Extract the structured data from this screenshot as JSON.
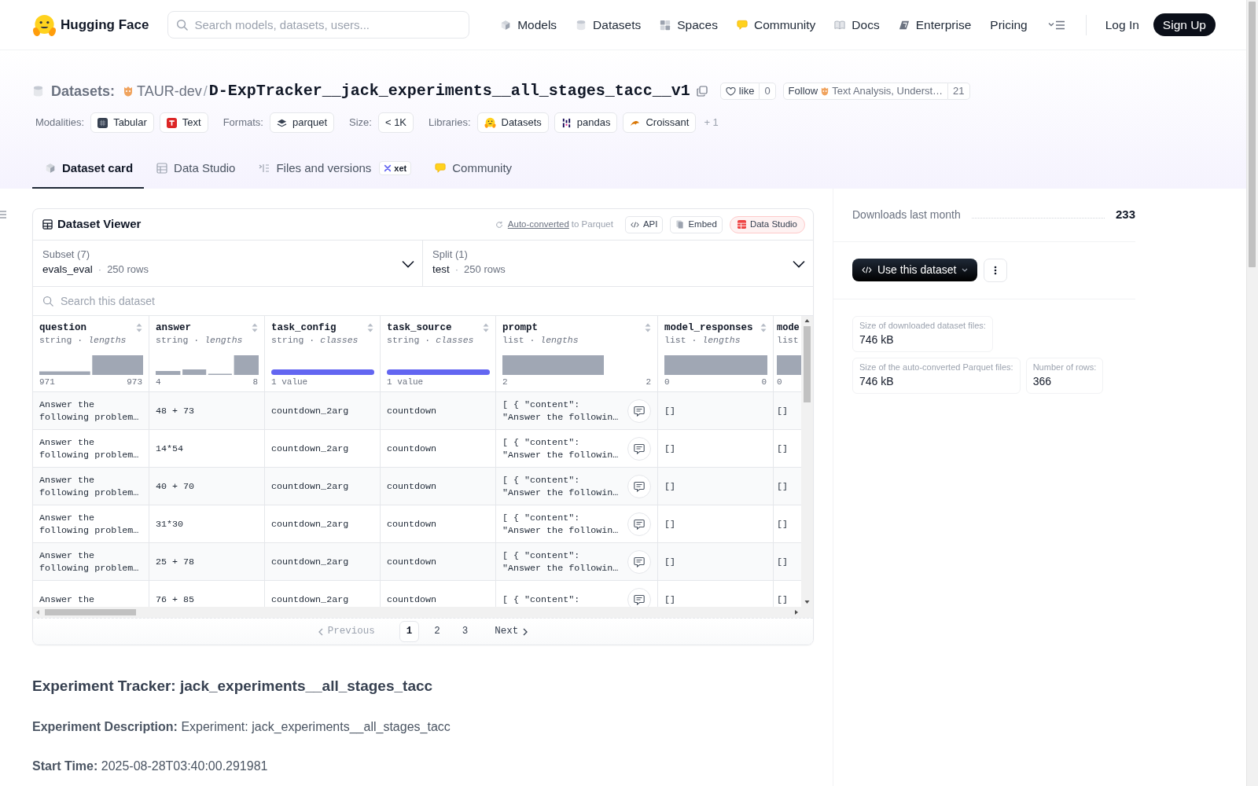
{
  "header": {
    "brand": "Hugging Face",
    "search": {
      "placeholder": "Search models, datasets, users..."
    },
    "nav": [
      {
        "label": "Models"
      },
      {
        "label": "Datasets"
      },
      {
        "label": "Spaces"
      },
      {
        "label": "Community"
      },
      {
        "label": "Docs"
      },
      {
        "label": "Enterprise"
      },
      {
        "label": "Pricing"
      }
    ],
    "login": "Log In",
    "signup": "Sign Up"
  },
  "repo": {
    "type_label": "Datasets:",
    "owner": "TAUR-dev",
    "separator": "/",
    "name": "D-ExpTracker__jack_experiments__all_stages_tacc__v1",
    "like": {
      "label": "like",
      "count": "0"
    },
    "follow": {
      "label": "Follow",
      "org": "Text Analysis, Underst…",
      "count": "21"
    }
  },
  "tag_groups": [
    {
      "label": "Modalities:",
      "tags": [
        "Tabular",
        "Text"
      ]
    },
    {
      "label": "Formats:",
      "tags": [
        "parquet"
      ]
    },
    {
      "label": "Size:",
      "tags": [
        "< 1K"
      ]
    },
    {
      "label": "Libraries:",
      "tags": [
        "Datasets",
        "pandas",
        "Croissant"
      ]
    }
  ],
  "more_tags": "+ 1",
  "tabs": [
    {
      "label": "Dataset card",
      "selected": true
    },
    {
      "label": "Data Studio",
      "selected": false
    },
    {
      "label": "Files and versions",
      "selected": false,
      "badge": "xet"
    },
    {
      "label": "Community",
      "selected": false
    }
  ],
  "viewer": {
    "title": "Dataset Viewer",
    "conversion": {
      "link": "Auto-converted",
      "text": "to Parquet"
    },
    "buttons": [
      {
        "label": "API",
        "kind": "plain"
      },
      {
        "label": "Embed",
        "kind": "plain"
      },
      {
        "label": "Data Studio",
        "kind": "highlight"
      }
    ],
    "selects": [
      {
        "label": "Subset (7)",
        "value": "evals_eval",
        "separator": "·",
        "rows": "250 rows"
      },
      {
        "label": "Split (1)",
        "value": "test",
        "separator": "·",
        "rows": "250 rows"
      }
    ],
    "search": {
      "placeholder": "Search this dataset"
    },
    "columns": [
      {
        "name": "question",
        "type": "string · *lengths*",
        "kind": "histogram",
        "min": "971",
        "max": "973",
        "expandable": false
      },
      {
        "name": "answer",
        "type": "string · *lengths*",
        "kind": "histogram",
        "min": "4",
        "max": "8",
        "expandable": false
      },
      {
        "name": "task_config",
        "type": "string · *classes*",
        "kind": "classes",
        "summary": "1 value",
        "expandable": false
      },
      {
        "name": "task_source",
        "type": "string · *classes*",
        "kind": "classes",
        "summary": "1 value",
        "expandable": false
      },
      {
        "name": "prompt",
        "type": "list · *lengths*",
        "kind": "histogram",
        "min": "2",
        "max": "2",
        "expandable": true
      },
      {
        "name": "model_responses",
        "type": "list · *lengths*",
        "kind": "histogram",
        "min": "0",
        "max": "0",
        "expandable": false
      },
      {
        "name": "mode",
        "type": "list",
        "kind": "histogram",
        "min": "0",
        "expandable": false
      }
    ],
    "rows": [
      [
        "Answer the following problem…",
        "48 + 73",
        "countdown_2arg",
        "countdown",
        "[ { \"content\": \"Answer the followin…",
        "[]",
        "[]"
      ],
      [
        "Answer the following problem…",
        "14*54",
        "countdown_2arg",
        "countdown",
        "[ { \"content\": \"Answer the followin…",
        "[]",
        "[]"
      ],
      [
        "Answer the following problem…",
        "40 + 70",
        "countdown_2arg",
        "countdown",
        "[ { \"content\": \"Answer the followin…",
        "[]",
        "[]"
      ],
      [
        "Answer the following problem…",
        "31*30",
        "countdown_2arg",
        "countdown",
        "[ { \"content\": \"Answer the followin…",
        "[]",
        "[]"
      ],
      [
        "Answer the following problem…",
        "25 + 78",
        "countdown_2arg",
        "countdown",
        "[ { \"content\": \"Answer the followin…",
        "[]",
        "[]"
      ],
      [
        "Answer the",
        "76 + 85",
        "countdown_2arg",
        "countdown",
        "[ { \"content\":",
        "[]",
        "[]"
      ]
    ],
    "pagination": {
      "previous": {
        "label": "Previous",
        "disabled": true
      },
      "pages": [
        {
          "label": "1",
          "selected": true
        },
        {
          "label": "2",
          "selected": false
        },
        {
          "label": "3",
          "selected": false
        }
      ],
      "next": {
        "label": "Next",
        "disabled": false
      }
    }
  },
  "sidebar": {
    "downloads": {
      "label": "Downloads last month",
      "value": "233"
    },
    "use_button": "Use this dataset",
    "stats": [
      {
        "label": "Size of downloaded dataset files:",
        "value": "746 kB"
      },
      {
        "label": "Size of the auto-converted Parquet files:",
        "value": "746 kB"
      },
      {
        "label": "Number of rows:",
        "value": "366"
      }
    ]
  },
  "readme": {
    "heading": "Experiment Tracker: jack_experiments__all_stages_tacc",
    "paragraphs": [
      "**Experiment Description:** Experiment: jack_experiments__all_stages_tacc",
      "**Start Time:** 2025-08-28T03:40:00.291981"
    ]
  }
}
